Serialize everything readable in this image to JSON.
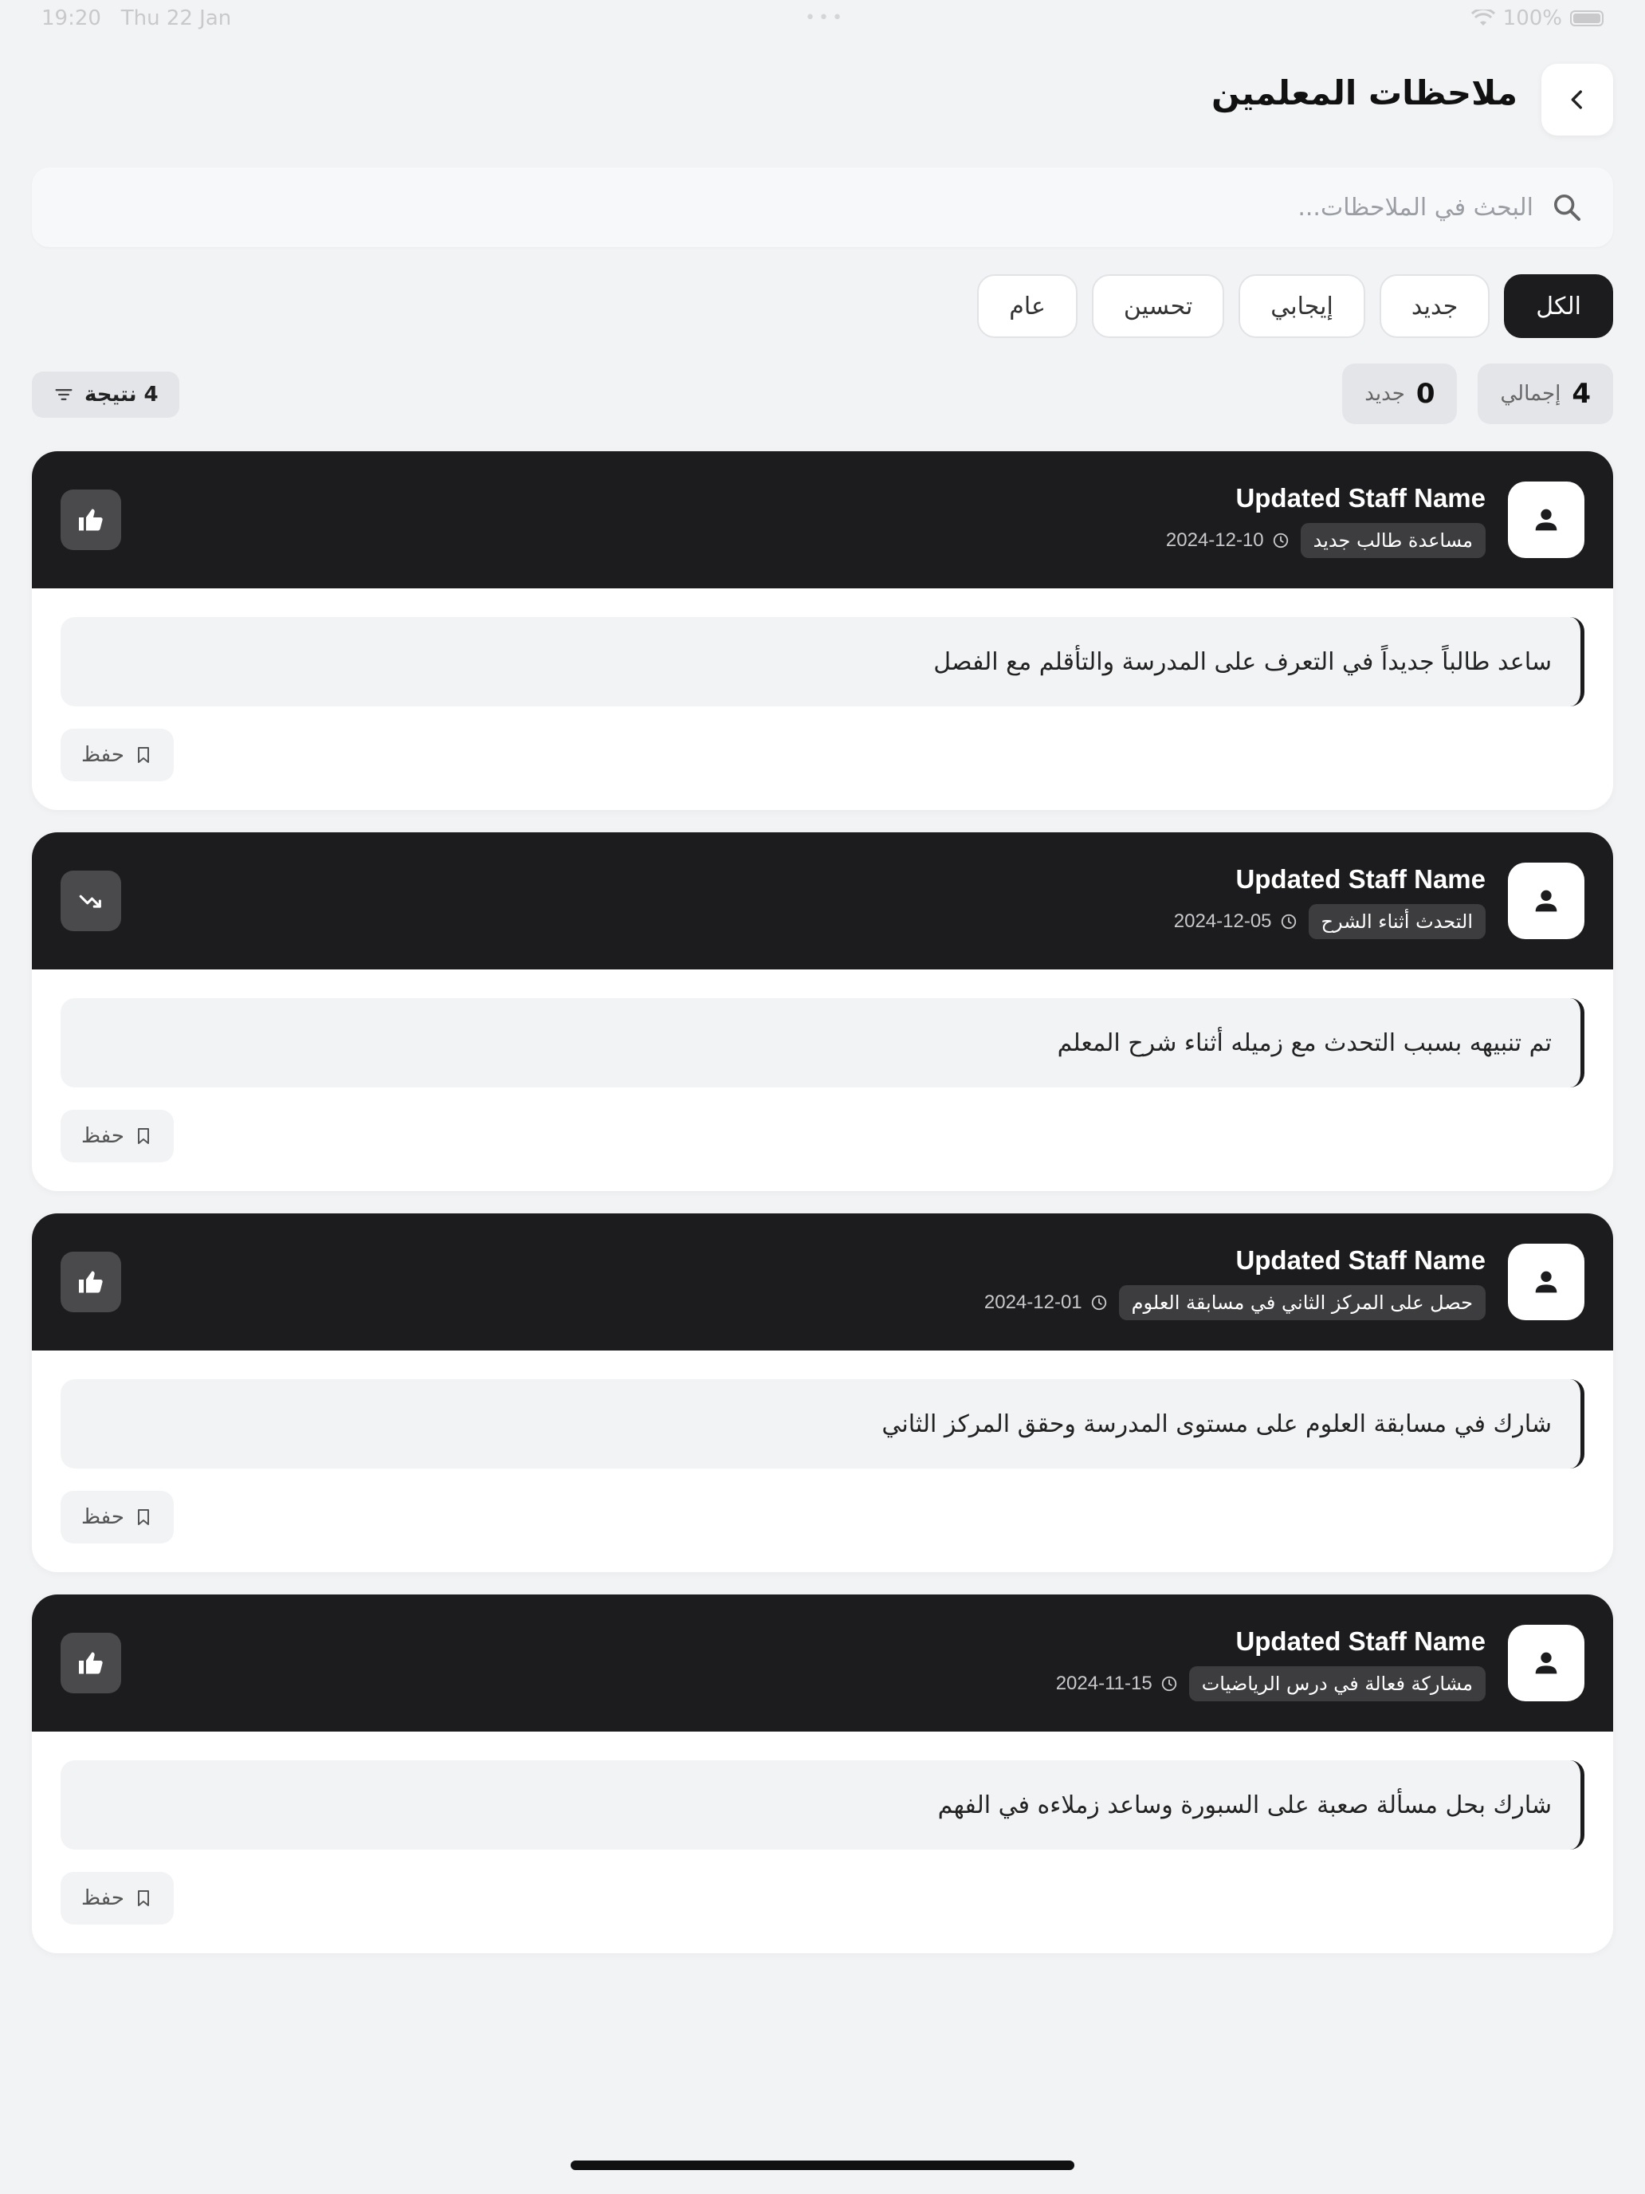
{
  "status_bar": {
    "time": "19:20",
    "date": "Thu 22 Jan",
    "battery": "100%"
  },
  "header": {
    "title": "ملاحظات المعلمين",
    "back_icon": "chevron-left-icon"
  },
  "search": {
    "placeholder": "البحث في الملاحظات...",
    "value": ""
  },
  "filters": [
    {
      "label": "الكل",
      "active": true
    },
    {
      "label": "جديد",
      "active": false
    },
    {
      "label": "إيجابي",
      "active": false
    },
    {
      "label": "تحسين",
      "active": false
    },
    {
      "label": "عام",
      "active": false
    }
  ],
  "stats": {
    "total_num": "4",
    "total_label": "إجمالي",
    "new_num": "0",
    "new_label": "جديد",
    "results": "4 نتيجة"
  },
  "notes": [
    {
      "staff": "Updated Staff Name",
      "tag": "مساعدة طالب جديد",
      "date": "2024-12-10",
      "type_icon": "thumbs-up-icon",
      "text": "ساعد طالباً جديداً في التعرف على المدرسة والتأقلم مع الفصل",
      "save_label": "حفظ"
    },
    {
      "staff": "Updated Staff Name",
      "tag": "التحدث أثناء الشرح",
      "date": "2024-12-05",
      "type_icon": "trending-down-icon",
      "text": "تم تنبيهه بسبب التحدث مع زميله أثناء شرح المعلم",
      "save_label": "حفظ"
    },
    {
      "staff": "Updated Staff Name",
      "tag": "حصل على المركز الثاني في مسابقة العلوم",
      "date": "2024-12-01",
      "type_icon": "thumbs-up-icon",
      "text": "شارك في مسابقة العلوم على مستوى المدرسة وحقق المركز الثاني",
      "save_label": "حفظ"
    },
    {
      "staff": "Updated Staff Name",
      "tag": "مشاركة فعالة في درس الرياضيات",
      "date": "2024-11-15",
      "type_icon": "thumbs-up-icon",
      "text": "شارك بحل مسألة صعبة على السبورة وساعد زملاءه في الفهم",
      "save_label": "حفظ"
    }
  ],
  "colors": {
    "background": "#f2f3f5",
    "card_header": "#1c1c1e",
    "accent_dark": "#1c1c1e"
  }
}
